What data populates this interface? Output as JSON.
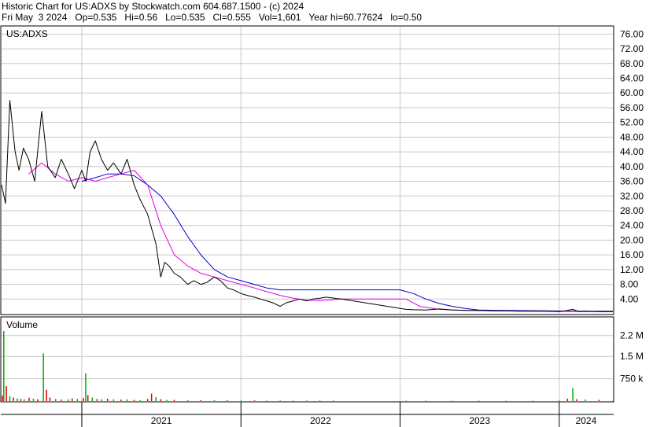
{
  "header": {
    "title": "Historic Chart for US:ADXS by Stockwatch.com 604.687.1500 - (c) 2024",
    "quote": "Fri May  3 2024   Op=0.535   Hi=0.56   Lo=0.535   Cl=0.555   Vol=1,601   Year hi=60.77624   lo=0.50"
  },
  "price_panel": {
    "label": "US:ADXS"
  },
  "volume_panel": {
    "label": "Volume"
  },
  "colors": {
    "price_line": "#000000",
    "ma_short": "#e000e0",
    "ma_long": "#0000cc",
    "vol_up": "#00b000",
    "vol_down": "#dd0000",
    "grid": "#c8c8c8",
    "frame": "#000000"
  },
  "chart_data": [
    {
      "type": "line",
      "title": "",
      "ylim": [
        0,
        78
      ],
      "y_ticks": [
        "76.00",
        "72.00",
        "68.00",
        "64.00",
        "60.00",
        "56.00",
        "52.00",
        "48.00",
        "44.00",
        "40.00",
        "36.00",
        "32.00",
        "28.00",
        "24.00",
        "20.00",
        "16.00",
        "12.00",
        "8.00",
        "4.00"
      ],
      "x_ticks": [
        "2021",
        "2022",
        "2023",
        "2024"
      ],
      "x_range": [
        "2020-07-01",
        "2024-05-03"
      ],
      "series": [
        {
          "id": "price",
          "x": [
            "2020-07-01",
            "2020-07-10",
            "2020-07-20",
            "2020-08-01",
            "2020-08-10",
            "2020-08-20",
            "2020-09-01",
            "2020-09-15",
            "2020-10-01",
            "2020-10-15",
            "2020-11-01",
            "2020-11-15",
            "2020-12-01",
            "2020-12-15",
            "2021-01-01",
            "2021-01-10",
            "2021-01-20",
            "2021-02-01",
            "2021-02-15",
            "2021-03-01",
            "2021-03-15",
            "2021-04-01",
            "2021-04-15",
            "2021-05-01",
            "2021-05-15",
            "2021-06-01",
            "2021-06-20",
            "2021-07-01",
            "2021-07-10",
            "2021-07-20",
            "2021-08-01",
            "2021-08-15",
            "2021-09-01",
            "2021-09-15",
            "2021-10-01",
            "2021-10-15",
            "2021-11-01",
            "2021-11-15",
            "2021-12-01",
            "2021-12-15",
            "2022-01-01",
            "2022-01-15",
            "2022-02-01",
            "2022-02-15",
            "2022-03-01",
            "2022-03-15",
            "2022-04-01",
            "2022-04-15",
            "2022-05-01",
            "2022-05-15",
            "2022-06-01",
            "2022-06-15",
            "2022-07-01",
            "2022-07-15",
            "2022-07-30",
            "2022-08-10",
            "2022-08-20",
            "2023-01-15",
            "2023-02-01",
            "2023-03-01",
            "2023-04-01",
            "2023-05-01",
            "2023-06-01",
            "2023-07-01",
            "2023-08-01",
            "2023-09-01",
            "2023-10-01",
            "2023-11-01",
            "2023-12-01",
            "2024-01-01",
            "2024-01-15",
            "2024-02-01",
            "2024-02-15",
            "2024-03-01",
            "2024-04-01",
            "2024-05-03"
          ],
          "y": [
            35,
            30,
            58,
            44,
            39,
            45,
            42,
            36,
            55,
            40,
            37,
            42,
            38,
            34,
            39,
            36,
            44,
            47,
            42,
            39,
            41,
            38,
            42,
            35,
            31,
            27,
            19,
            10,
            14,
            13,
            11,
            10,
            8,
            9,
            8,
            8.5,
            10,
            9,
            7,
            6.5,
            5.5,
            5,
            4.5,
            4,
            3.5,
            3,
            2,
            3,
            3.5,
            4,
            3.5,
            4,
            4.2,
            4.5,
            4.3,
            4.1,
            4.0,
            1.2,
            1.1,
            1.0,
            1.3,
            1.0,
            0.9,
            0.9,
            0.8,
            0.8,
            0.7,
            0.7,
            0.7,
            0.6,
            0.8,
            1.2,
            0.6,
            0.7,
            0.6,
            0.555
          ]
        },
        {
          "id": "ma_short",
          "x": [
            "2020-09-01",
            "2020-10-01",
            "2020-11-01",
            "2020-12-01",
            "2021-01-01",
            "2021-02-01",
            "2021-03-01",
            "2021-04-01",
            "2021-05-01",
            "2021-06-01",
            "2021-07-01",
            "2021-08-01",
            "2021-09-01",
            "2021-10-01",
            "2021-11-01",
            "2021-12-01",
            "2022-01-01",
            "2022-02-01",
            "2022-03-01",
            "2022-04-01",
            "2022-05-01",
            "2022-06-01",
            "2022-07-01",
            "2022-08-20",
            "2023-01-01",
            "2023-01-15",
            "2023-02-15",
            "2023-04-01",
            "2023-06-01",
            "2023-09-01",
            "2023-12-01",
            "2024-03-01",
            "2024-05-03"
          ],
          "y": [
            38,
            41,
            38,
            36,
            37,
            36,
            37,
            38,
            39,
            35,
            24,
            16,
            13,
            11,
            10,
            9,
            8,
            7,
            6,
            5,
            4.2,
            3.7,
            3.6,
            4.0,
            4.0,
            4.0,
            2.0,
            1.2,
            0.9,
            0.8,
            0.7,
            0.6,
            0.6
          ]
        },
        {
          "id": "ma_long",
          "x": [
            "2021-01-01",
            "2021-02-01",
            "2021-03-01",
            "2021-04-01",
            "2021-05-01",
            "2021-06-01",
            "2021-07-01",
            "2021-08-01",
            "2021-09-01",
            "2021-10-01",
            "2021-11-01",
            "2021-12-01",
            "2022-01-01",
            "2022-02-01",
            "2022-03-01",
            "2022-04-01",
            "2022-05-01",
            "2022-06-01",
            "2022-07-01",
            "2022-08-20",
            "2023-01-01",
            "2023-02-01",
            "2023-03-01",
            "2023-04-01",
            "2023-05-01",
            "2023-06-01",
            "2023-07-01",
            "2023-09-01",
            "2023-12-01",
            "2024-03-01",
            "2024-05-03"
          ],
          "y": [
            36,
            37,
            38,
            38,
            37.5,
            35,
            32,
            27,
            21,
            16,
            12,
            10,
            9,
            8,
            7,
            6.5,
            6.5,
            6.5,
            6.5,
            6.5,
            6.5,
            5.5,
            4.0,
            2.8,
            2.0,
            1.4,
            1.0,
            0.9,
            0.8,
            0.7,
            0.7
          ]
        }
      ]
    },
    {
      "type": "bar",
      "title": "",
      "ylim": [
        0,
        2800
      ],
      "y_ticks": [
        "2.2 M",
        "1.5 M",
        "750 k"
      ],
      "units": "thousand shares",
      "x": [
        "2020-07-03",
        "2020-07-06",
        "2020-07-12",
        "2020-07-20",
        "2020-07-28",
        "2020-08-06",
        "2020-08-14",
        "2020-08-22",
        "2020-09-02",
        "2020-09-12",
        "2020-09-22",
        "2020-10-05",
        "2020-10-12",
        "2020-10-20",
        "2020-11-02",
        "2020-11-15",
        "2020-12-01",
        "2020-12-10",
        "2020-12-22",
        "2021-01-05",
        "2021-01-10",
        "2021-01-15",
        "2021-01-25",
        "2021-02-05",
        "2021-02-15",
        "2021-03-01",
        "2021-03-15",
        "2021-04-01",
        "2021-04-15",
        "2021-05-01",
        "2021-05-15",
        "2021-06-01",
        "2021-06-10",
        "2021-06-20",
        "2021-07-01",
        "2021-07-15",
        "2021-08-01",
        "2021-09-01",
        "2021-10-01",
        "2021-11-01",
        "2021-12-01",
        "2022-01-01",
        "2022-02-01",
        "2022-03-01",
        "2022-04-01",
        "2022-05-01",
        "2022-06-01",
        "2022-07-01",
        "2022-08-01",
        "2023-01-15",
        "2023-03-01",
        "2023-05-01",
        "2023-07-01",
        "2023-09-01",
        "2023-11-01",
        "2024-01-01",
        "2024-01-20",
        "2024-02-01",
        "2024-02-10",
        "2024-03-01",
        "2024-04-01",
        "2024-05-03"
      ],
      "values": [
        180,
        2350,
        500,
        160,
        120,
        90,
        70,
        60,
        110,
        80,
        60,
        1600,
        380,
        120,
        70,
        50,
        60,
        90,
        70,
        100,
        930,
        200,
        120,
        70,
        60,
        80,
        60,
        50,
        60,
        40,
        30,
        70,
        250,
        130,
        60,
        40,
        40,
        30,
        30,
        25,
        25,
        20,
        20,
        15,
        15,
        15,
        15,
        20,
        15,
        10,
        10,
        10,
        10,
        10,
        10,
        20,
        80,
        440,
        60,
        50,
        40,
        5
      ],
      "up": [
        false,
        true,
        false,
        true,
        false,
        true,
        false,
        true,
        false,
        true,
        false,
        true,
        false,
        false,
        true,
        false,
        true,
        false,
        true,
        false,
        true,
        false,
        true,
        false,
        true,
        false,
        true,
        false,
        true,
        false,
        true,
        false,
        false,
        true,
        false,
        true,
        false,
        true,
        false,
        true,
        false,
        true,
        false,
        true,
        false,
        true,
        false,
        true,
        false,
        true,
        false,
        true,
        false,
        true,
        false,
        true,
        false,
        true,
        false,
        true,
        false,
        true
      ]
    }
  ]
}
